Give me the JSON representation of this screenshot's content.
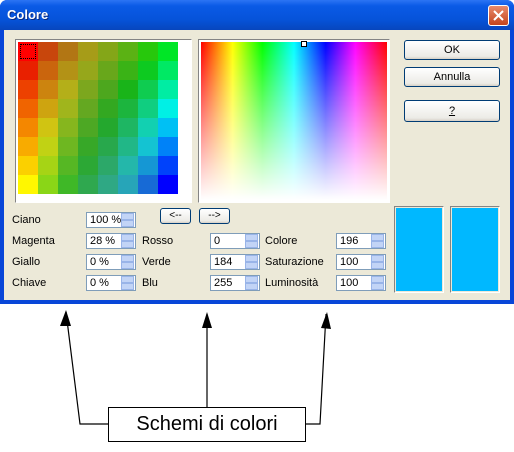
{
  "window": {
    "title": "Colore"
  },
  "buttons": {
    "ok": "OK",
    "cancel": "Annulla",
    "help": "?",
    "left_arrow": "<--",
    "right_arrow": "-->"
  },
  "cmyk": [
    {
      "label": "Ciano",
      "value": "100 %"
    },
    {
      "label": "Magenta",
      "value": "28 %"
    },
    {
      "label": "Giallo",
      "value": "0 %"
    },
    {
      "label": "Chiave",
      "value": "0 %"
    }
  ],
  "rgb": [
    {
      "label": "Rosso",
      "value": "0"
    },
    {
      "label": "Verde",
      "value": "184"
    },
    {
      "label": "Blu",
      "value": "255"
    }
  ],
  "hsb": [
    {
      "label": "Colore",
      "value": "196"
    },
    {
      "label": "Saturazione",
      "value": "100"
    },
    {
      "label": "Luminosità",
      "value": "100"
    }
  ],
  "colors": {
    "preview_old": "#00b8ff",
    "preview_new": "#00b8ff"
  },
  "annotation": {
    "text": "Schemi di colori"
  }
}
